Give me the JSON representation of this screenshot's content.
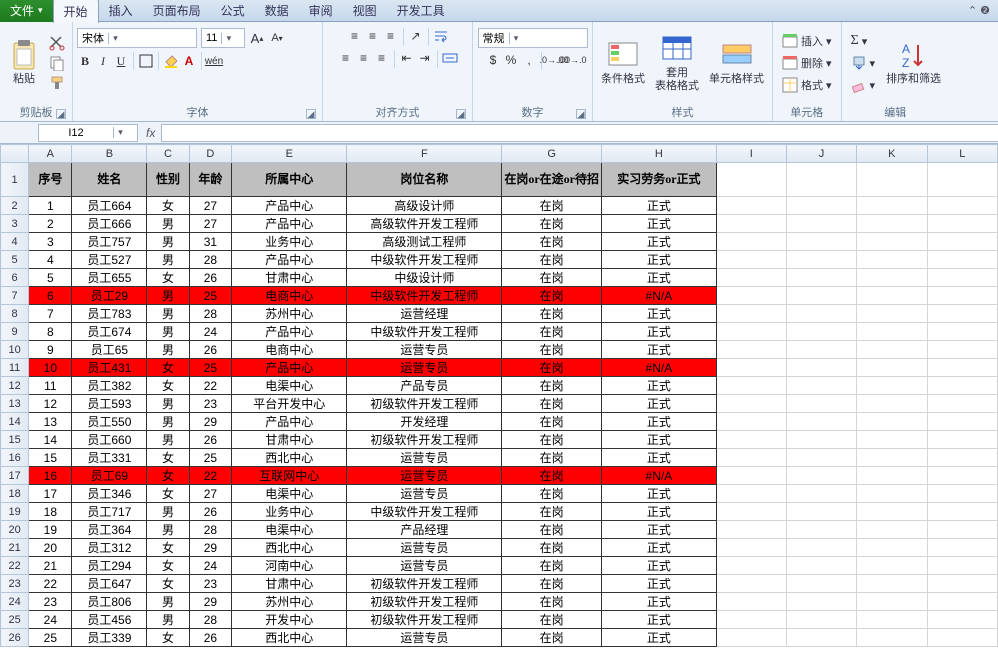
{
  "titlebar": {
    "file_label": "文件",
    "tabs": [
      "开始",
      "插入",
      "页面布局",
      "公式",
      "数据",
      "审阅",
      "视图",
      "开发工具"
    ],
    "active_tab": 0,
    "help_hint": "⌃ ❷"
  },
  "ribbon": {
    "clipboard": {
      "label": "剪贴板",
      "paste": "粘贴"
    },
    "font": {
      "label": "字体",
      "name": "宋体",
      "size": "11",
      "bold": "B",
      "italic": "I",
      "underline": "U"
    },
    "align": {
      "label": "对齐方式"
    },
    "number": {
      "label": "数字",
      "format": "常规"
    },
    "styles": {
      "label": "样式",
      "cond": "条件格式",
      "table": "套用\n表格格式",
      "cell": "单元格样式"
    },
    "cells": {
      "label": "单元格",
      "insert": "插入",
      "delete": "删除",
      "format": "格式"
    },
    "editing": {
      "label": "编辑",
      "sort": "排序和筛选"
    }
  },
  "fxbar": {
    "namebox": "I12",
    "fx": "fx"
  },
  "columns": [
    "A",
    "B",
    "C",
    "D",
    "E",
    "F",
    "G",
    "H",
    "I",
    "J",
    "K",
    "L"
  ],
  "headers": [
    "序号",
    "姓名",
    "性别",
    "年龄",
    "所属中心",
    "岗位名称",
    "在岗or在途or待招",
    "实习劳务or正式"
  ],
  "rows": [
    {
      "n": 1,
      "d": [
        "1",
        "员工664",
        "女",
        "27",
        "产品中心",
        "高级设计师",
        "在岗",
        "正式"
      ]
    },
    {
      "n": 2,
      "d": [
        "2",
        "员工666",
        "男",
        "27",
        "产品中心",
        "高级软件开发工程师",
        "在岗",
        "正式"
      ]
    },
    {
      "n": 3,
      "d": [
        "3",
        "员工757",
        "男",
        "31",
        "业务中心",
        "高级测试工程师",
        "在岗",
        "正式"
      ]
    },
    {
      "n": 4,
      "d": [
        "4",
        "员工527",
        "男",
        "28",
        "产品中心",
        "中级软件开发工程师",
        "在岗",
        "正式"
      ]
    },
    {
      "n": 5,
      "d": [
        "5",
        "员工655",
        "女",
        "26",
        "甘肃中心",
        "中级设计师",
        "在岗",
        "正式"
      ]
    },
    {
      "n": 6,
      "d": [
        "6",
        "员工29",
        "男",
        "25",
        "电商中心",
        "中级软件开发工程师",
        "在岗",
        "#N/A"
      ],
      "red": true
    },
    {
      "n": 7,
      "d": [
        "7",
        "员工783",
        "男",
        "28",
        "苏州中心",
        "运营经理",
        "在岗",
        "正式"
      ]
    },
    {
      "n": 8,
      "d": [
        "8",
        "员工674",
        "男",
        "24",
        "产品中心",
        "中级软件开发工程师",
        "在岗",
        "正式"
      ]
    },
    {
      "n": 9,
      "d": [
        "9",
        "员工65",
        "男",
        "26",
        "电商中心",
        "运营专员",
        "在岗",
        "正式"
      ]
    },
    {
      "n": 10,
      "d": [
        "10",
        "员工431",
        "女",
        "25",
        "产品中心",
        "运营专员",
        "在岗",
        "#N/A"
      ],
      "red": true
    },
    {
      "n": 11,
      "d": [
        "11",
        "员工382",
        "女",
        "22",
        "电渠中心",
        "产品专员",
        "在岗",
        "正式"
      ]
    },
    {
      "n": 12,
      "d": [
        "12",
        "员工593",
        "男",
        "23",
        "平台开发中心",
        "初级软件开发工程师",
        "在岗",
        "正式"
      ]
    },
    {
      "n": 13,
      "d": [
        "13",
        "员工550",
        "男",
        "29",
        "产品中心",
        "开发经理",
        "在岗",
        "正式"
      ]
    },
    {
      "n": 14,
      "d": [
        "14",
        "员工660",
        "男",
        "26",
        "甘肃中心",
        "初级软件开发工程师",
        "在岗",
        "正式"
      ]
    },
    {
      "n": 15,
      "d": [
        "15",
        "员工331",
        "女",
        "25",
        "西北中心",
        "运营专员",
        "在岗",
        "正式"
      ]
    },
    {
      "n": 16,
      "d": [
        "16",
        "员工69",
        "女",
        "22",
        "互联网中心",
        "运营专员",
        "在岗",
        "#N/A"
      ],
      "red": true
    },
    {
      "n": 17,
      "d": [
        "17",
        "员工346",
        "女",
        "27",
        "电渠中心",
        "运营专员",
        "在岗",
        "正式"
      ]
    },
    {
      "n": 18,
      "d": [
        "18",
        "员工717",
        "男",
        "26",
        "业务中心",
        "中级软件开发工程师",
        "在岗",
        "正式"
      ]
    },
    {
      "n": 19,
      "d": [
        "19",
        "员工364",
        "男",
        "28",
        "电渠中心",
        "产品经理",
        "在岗",
        "正式"
      ]
    },
    {
      "n": 20,
      "d": [
        "20",
        "员工312",
        "女",
        "29",
        "西北中心",
        "运营专员",
        "在岗",
        "正式"
      ]
    },
    {
      "n": 21,
      "d": [
        "21",
        "员工294",
        "女",
        "24",
        "河南中心",
        "运营专员",
        "在岗",
        "正式"
      ]
    },
    {
      "n": 22,
      "d": [
        "22",
        "员工647",
        "女",
        "23",
        "甘肃中心",
        "初级软件开发工程师",
        "在岗",
        "正式"
      ]
    },
    {
      "n": 23,
      "d": [
        "23",
        "员工806",
        "男",
        "29",
        "苏州中心",
        "初级软件开发工程师",
        "在岗",
        "正式"
      ]
    },
    {
      "n": 24,
      "d": [
        "24",
        "员工456",
        "男",
        "28",
        "开发中心",
        "初级软件开发工程师",
        "在岗",
        "正式"
      ]
    },
    {
      "n": 25,
      "d": [
        "25",
        "员工339",
        "女",
        "26",
        "西北中心",
        "运营专员",
        "在岗",
        "正式"
      ]
    }
  ]
}
